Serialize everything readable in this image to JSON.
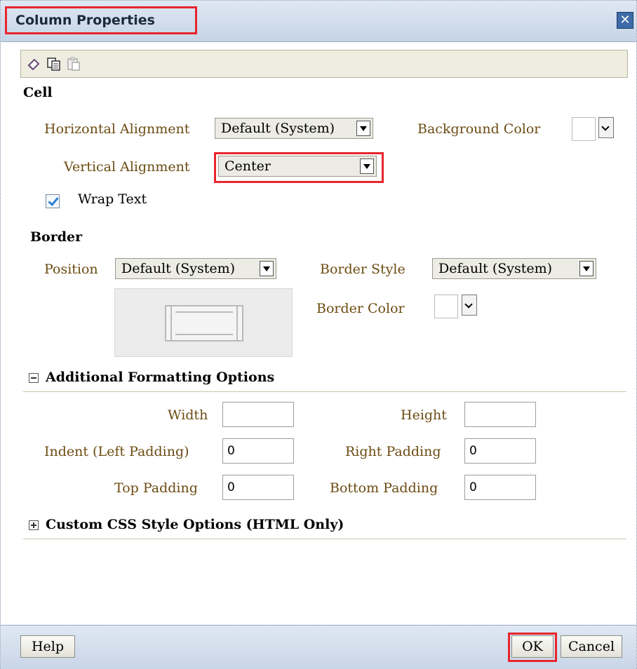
{
  "dialog": {
    "title": "Column Properties",
    "close_icon": "close-icon"
  },
  "toolbar": {
    "icons": [
      "eraser-icon",
      "copy-icon",
      "paste-icon"
    ]
  },
  "cell": {
    "heading": "Cell",
    "horizontal_alignment_label": "Horizontal Alignment",
    "horizontal_alignment_value": "Default (System)",
    "background_color_label": "Background Color",
    "vertical_alignment_label": "Vertical Alignment",
    "vertical_alignment_value": "Center",
    "wrap_text_label": "Wrap Text",
    "wrap_text_checked": true
  },
  "border": {
    "heading": "Border",
    "position_label": "Position",
    "position_value": "Default (System)",
    "style_label": "Border Style",
    "style_value": "Default (System)",
    "color_label": "Border Color"
  },
  "additional": {
    "heading": "Additional Formatting Options",
    "expanded": true,
    "width_label": "Width",
    "width_value": "",
    "height_label": "Height",
    "height_value": "",
    "indent_label": "Indent (Left Padding)",
    "indent_value": "0",
    "right_padding_label": "Right Padding",
    "right_padding_value": "0",
    "top_padding_label": "Top Padding",
    "top_padding_value": "0",
    "bottom_padding_label": "Bottom Padding",
    "bottom_padding_value": "0"
  },
  "custom_css": {
    "heading": "Custom CSS Style Options (HTML Only)",
    "expanded": false
  },
  "footer": {
    "help_label": "Help",
    "ok_label": "OK",
    "cancel_label": "Cancel"
  },
  "colors": {
    "highlight": "#e8262e",
    "label_text": "#6b4b12",
    "titlebar": "#c6d4e6"
  }
}
